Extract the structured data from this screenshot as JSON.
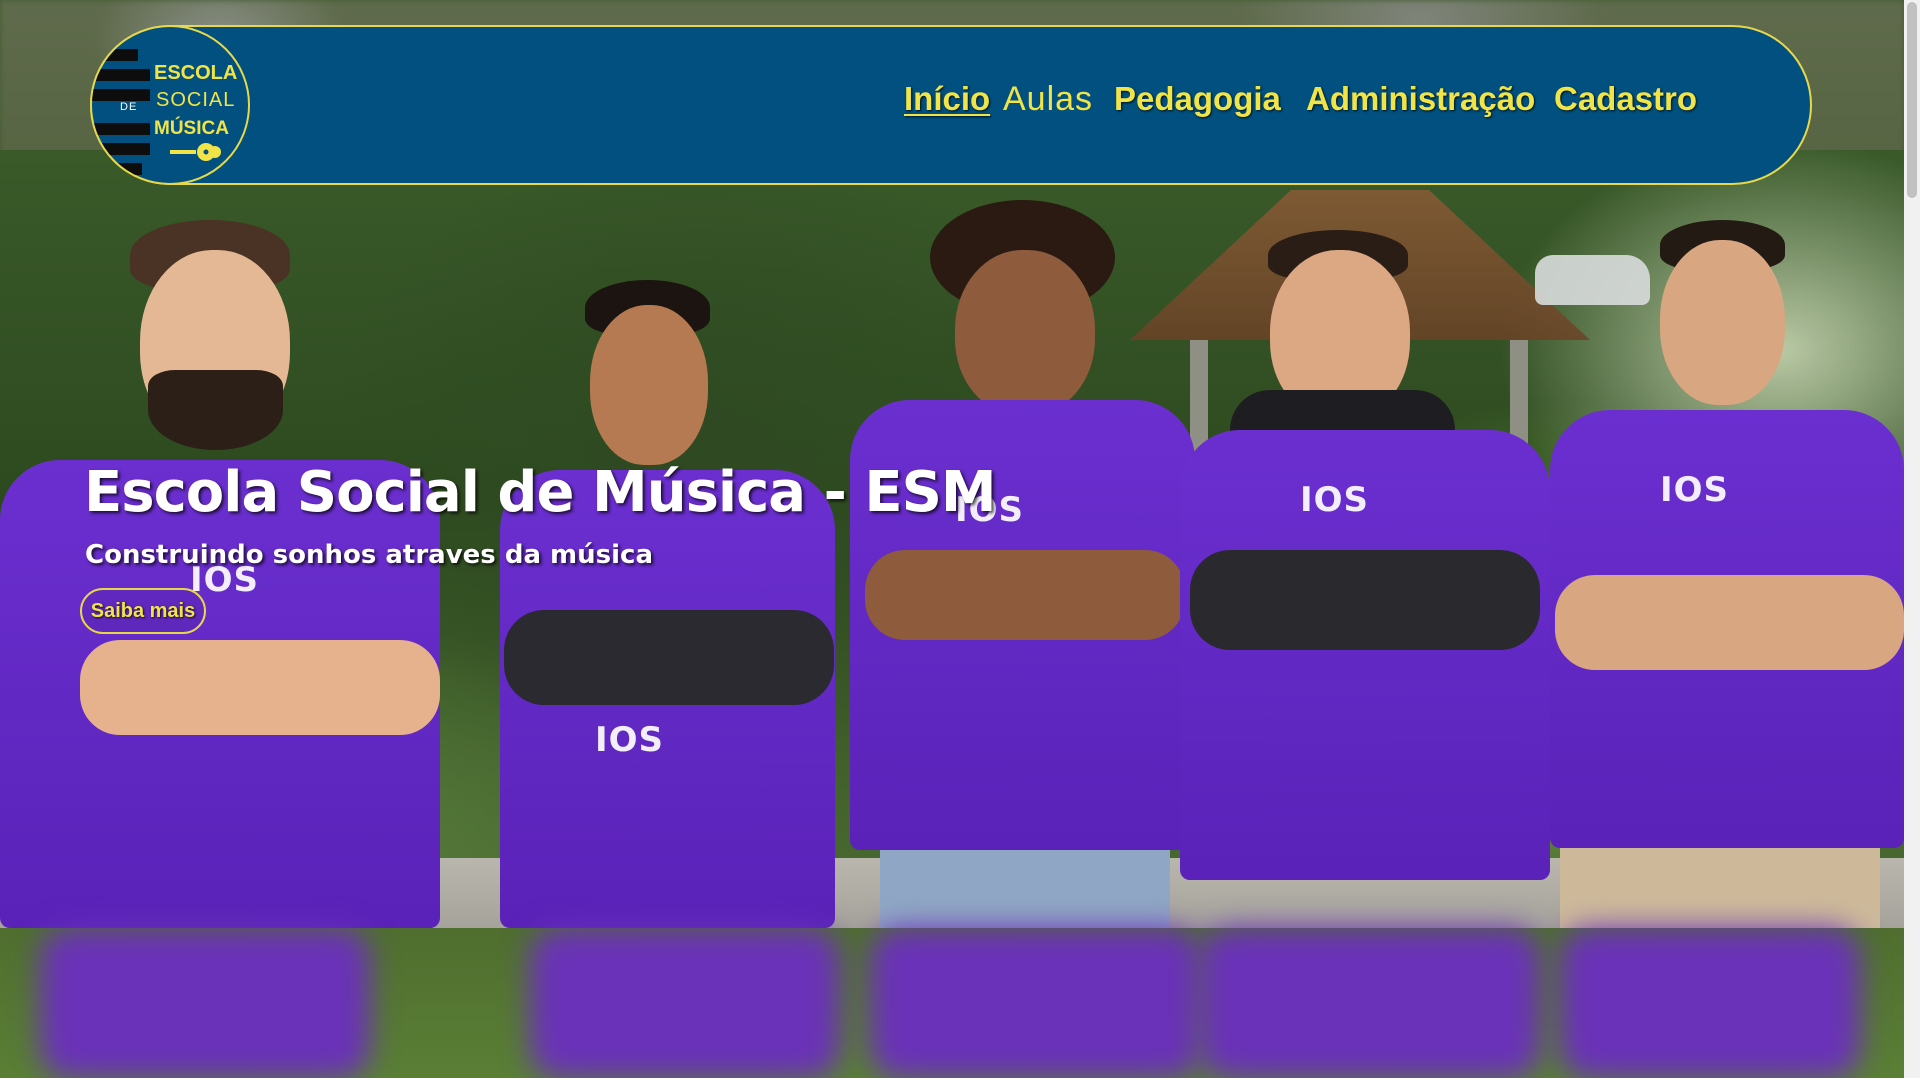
{
  "brand": {
    "logo_line1": "ESCOLA",
    "logo_line2": "SOCIAL",
    "logo_line3": "MÚSICA",
    "logo_de": "DE",
    "colors": {
      "navy": "#01507f",
      "yellow": "#f0e447",
      "purple_shirt": "#6b2fd0"
    }
  },
  "nav": {
    "items": [
      {
        "label": "Início",
        "active": true
      },
      {
        "label": "Aulas",
        "active": false
      },
      {
        "label": "Pedagogia",
        "active": false
      },
      {
        "label": "Administração",
        "active": false
      },
      {
        "label": "Cadastro",
        "active": false
      }
    ]
  },
  "hero": {
    "title": "Escola Social de Música - ESM",
    "subtitle": "Construindo sonhos atraves da música",
    "cta_label": "Saiba mais",
    "shirt_logo": "IOS"
  }
}
